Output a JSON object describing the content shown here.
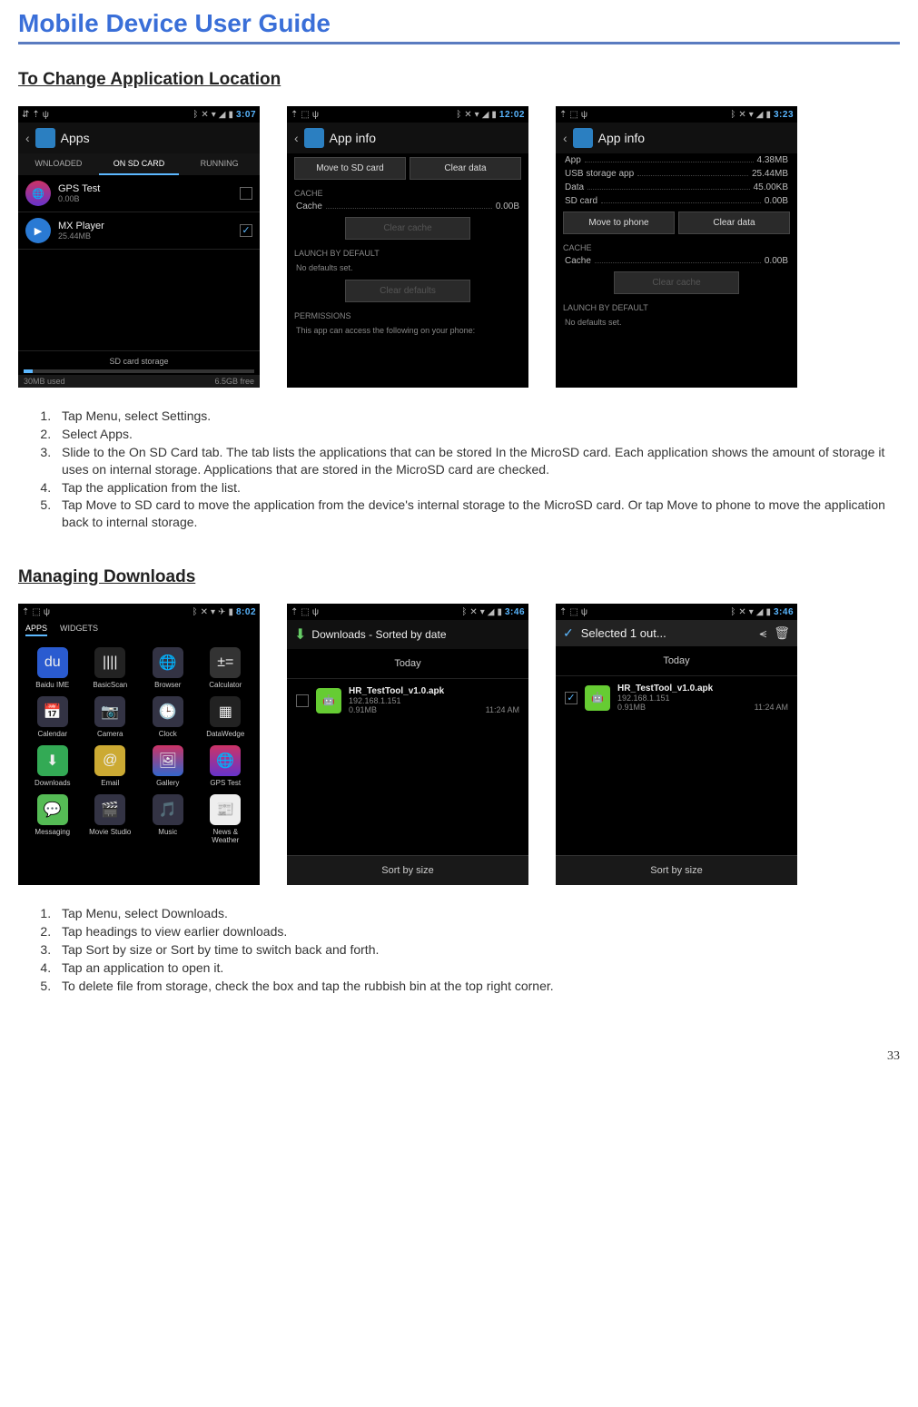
{
  "doc_title": "Mobile Device User Guide",
  "page_number": "33",
  "section1": {
    "heading": "To Change Application Location",
    "steps": [
      "Tap Menu, select Settings.",
      "Select Apps.",
      "Slide to the On SD Card tab. The tab lists the applications that can be stored In the MicroSD card. Each application shows the amount of storage it uses on internal storage. Applications that are stored in the MicroSD card are checked.",
      "Tap the application from the list.",
      "Tap Move to SD card to move the application from the device's internal storage to the MicroSD card. Or tap Move to phone to move the application back to internal storage."
    ],
    "shot1": {
      "time": "3:07",
      "title": "Apps",
      "tabs": {
        "t1": "WNLOADED",
        "t2": "ON SD CARD",
        "t3": "RUNNING"
      },
      "item1": {
        "name": "GPS Test",
        "sub": "0.00B"
      },
      "item2": {
        "name": "MX Player",
        "sub": "25.44MB"
      },
      "storage_label": "SD card storage",
      "storage_used": "30MB used",
      "storage_free": "6.5GB free"
    },
    "shot2": {
      "time": "12:02",
      "title": "App info",
      "btn_move": "Move to SD card",
      "btn_clear": "Clear data",
      "cache_label": "CACHE",
      "cache": "Cache",
      "cache_val": "0.00B",
      "btn_clear_cache": "Clear cache",
      "launch_label": "LAUNCH BY DEFAULT",
      "no_defaults": "No defaults set.",
      "btn_clear_defaults": "Clear defaults",
      "perm_label": "PERMISSIONS",
      "perm_text": "This app can access the following on your phone:"
    },
    "shot3": {
      "time": "3:23",
      "title": "App info",
      "rows": {
        "app": "App",
        "app_v": "4.38MB",
        "usb": "USB storage app",
        "usb_v": "25.44MB",
        "data": "Data",
        "data_v": "45.00KB",
        "sd": "SD card",
        "sd_v": "0.00B"
      },
      "btn_move": "Move to phone",
      "btn_clear": "Clear data",
      "cache_label": "CACHE",
      "cache": "Cache",
      "cache_val": "0.00B",
      "btn_clear_cache": "Clear cache",
      "launch_label": "LAUNCH BY DEFAULT",
      "no_defaults": "No defaults set."
    }
  },
  "section2": {
    "heading": "Managing Downloads",
    "steps": [
      "Tap Menu, select Downloads.",
      "Tap headings to view earlier downloads.",
      "Tap Sort by size or Sort by time to switch back and forth.",
      "Tap an application to open it.",
      "To delete file from storage, check the box and tap the rubbish bin at the top right corner."
    ],
    "shot1": {
      "time": "8:02",
      "tab_apps": "APPS",
      "tab_widgets": "WIDGETS",
      "apps": [
        "Baidu IME",
        "BasicScan",
        "Browser",
        "Calculator",
        "Calendar",
        "Camera",
        "Clock",
        "DataWedge",
        "Downloads",
        "Email",
        "Gallery",
        "GPS Test",
        "Messaging",
        "Movie Studio",
        "Music",
        "News & Weather"
      ]
    },
    "shot2": {
      "time": "3:46",
      "title": "Downloads - Sorted by date",
      "group": "Today",
      "file_name": "HR_TestTool_v1.0.apk",
      "file_host": "192.168.1.151",
      "file_size": "0.91MB",
      "file_time": "11:24 AM",
      "sort": "Sort by size"
    },
    "shot3": {
      "time": "3:46",
      "title": "Selected 1 out...",
      "group": "Today",
      "file_name": "HR_TestTool_v1.0.apk",
      "file_host": "192.168.1.151",
      "file_size": "0.91MB",
      "file_time": "11:24 AM",
      "sort": "Sort by size"
    }
  }
}
